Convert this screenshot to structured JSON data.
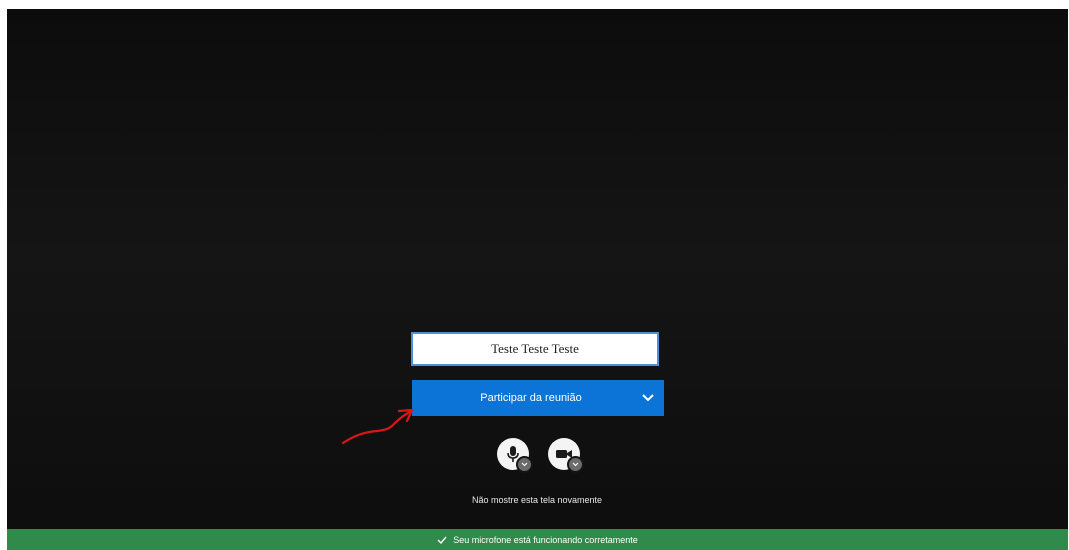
{
  "prejoin": {
    "name_input": {
      "value": "Teste Teste Teste",
      "placeholder": ""
    },
    "join_button": {
      "label": "Participar da reunião"
    },
    "mic_button": {
      "icon": "microphone-icon",
      "badge_icon": "chevron-down-icon"
    },
    "camera_button": {
      "icon": "camera-icon",
      "badge_icon": "chevron-down-icon"
    },
    "dont_show_again": "Não mostre esta tela novamente"
  },
  "status_bar": {
    "icon": "check-icon",
    "message": "Seu microfone está funcionando corretamente"
  },
  "colors": {
    "join_button": "#0b74d6",
    "status_bar": "#2f8a4c",
    "annotation_arrow": "#d81818",
    "background": "#111111"
  }
}
